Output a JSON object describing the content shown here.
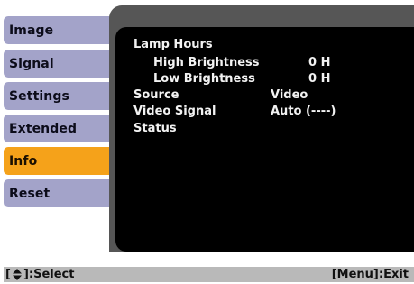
{
  "menu": {
    "items": [
      {
        "label": "Image"
      },
      {
        "label": "Signal"
      },
      {
        "label": "Settings"
      },
      {
        "label": "Extended"
      },
      {
        "label": "Info"
      },
      {
        "label": "Reset"
      }
    ],
    "active_index": 4,
    "colors": {
      "tab": "#a3a3c9",
      "active_tab": "#f5a21a",
      "panel": "#565656",
      "content_bg": "#000000"
    }
  },
  "info": {
    "lamp_hours_label": "Lamp Hours",
    "high_brightness_label": "High Brightness",
    "high_brightness_value": "0 H",
    "low_brightness_label": "Low Brightness",
    "low_brightness_value": "0 H",
    "source_label": "Source",
    "source_value": "Video",
    "video_signal_label": "Video Signal",
    "video_signal_value": "Auto (----)",
    "status_label": "Status"
  },
  "footer": {
    "open_bracket": "[",
    "select_icon": "up-down-arrow-icon",
    "select_text": "]:Select",
    "exit_text": "[Menu]:Exit"
  }
}
